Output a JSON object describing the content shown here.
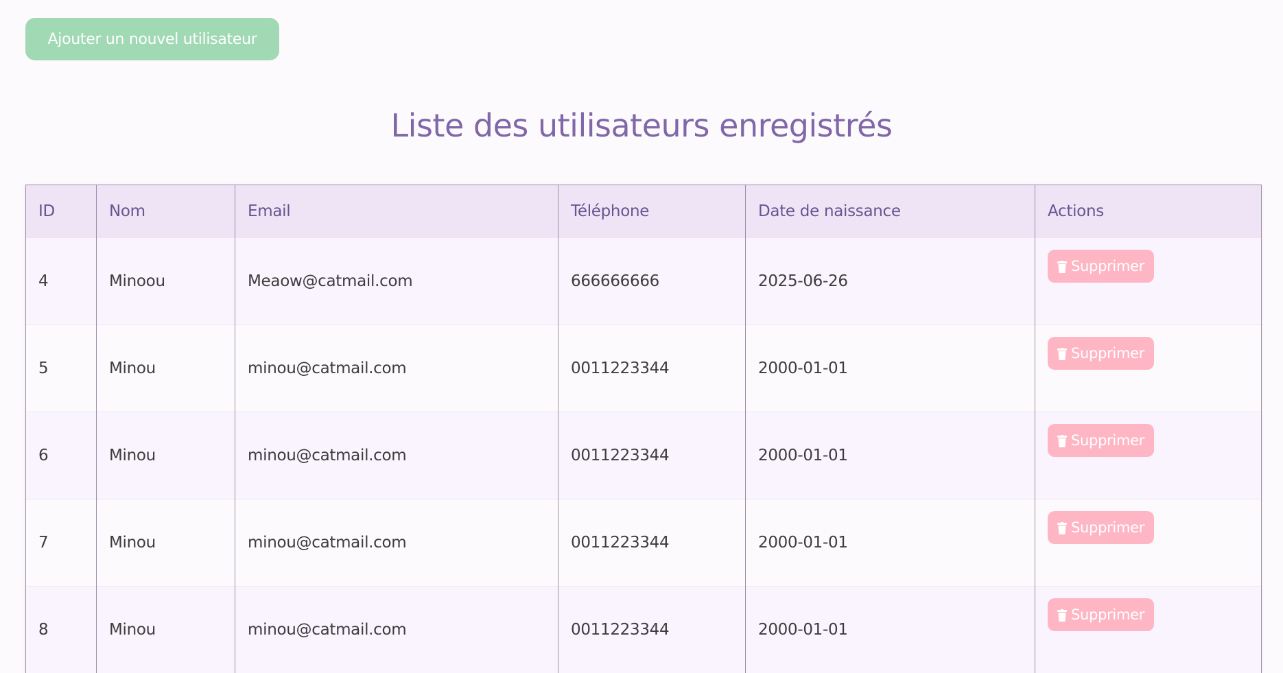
{
  "toolbar": {
    "add_user_label": "Ajouter un nouvel utilisateur"
  },
  "page": {
    "title": "Liste des utilisateurs enregistrés"
  },
  "table": {
    "headers": [
      "ID",
      "Nom",
      "Email",
      "Téléphone",
      "Date de naissance",
      "Actions"
    ],
    "rows": [
      {
        "id": "4",
        "name": "Minoou",
        "email": "Meaow@catmail.com",
        "phone": "666666666",
        "birthdate": "2025-06-26",
        "action_label": "Supprimer"
      },
      {
        "id": "5",
        "name": "Minou",
        "email": "minou@catmail.com",
        "phone": "0011223344",
        "birthdate": "2000-01-01",
        "action_label": "Supprimer"
      },
      {
        "id": "6",
        "name": "Minou",
        "email": "minou@catmail.com",
        "phone": "0011223344",
        "birthdate": "2000-01-01",
        "action_label": "Supprimer"
      },
      {
        "id": "7",
        "name": "Minou",
        "email": "minou@catmail.com",
        "phone": "0011223344",
        "birthdate": "2000-01-01",
        "action_label": "Supprimer"
      },
      {
        "id": "8",
        "name": "Minou",
        "email": "minou@catmail.com",
        "phone": "0011223344",
        "birthdate": "2000-01-01",
        "action_label": "Supprimer"
      }
    ]
  },
  "icons": {
    "delete": "trash-icon"
  },
  "colors": {
    "add_button": "#a0d9b4",
    "delete_button": "#ffb6c4",
    "title": "#8068a8",
    "header_bg": "#efe4f5"
  }
}
